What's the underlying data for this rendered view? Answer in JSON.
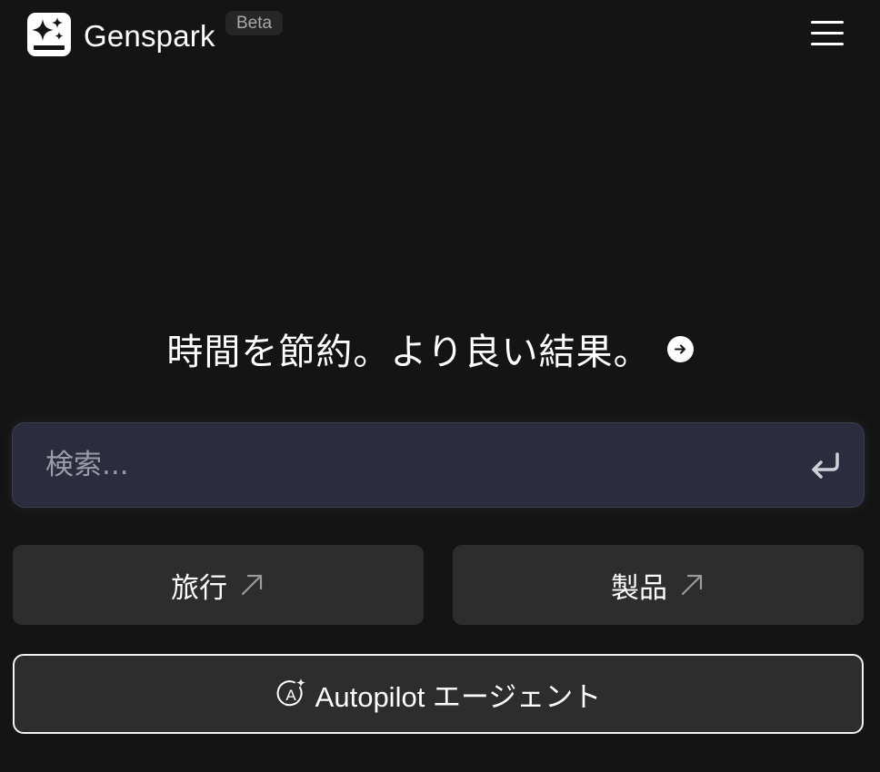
{
  "header": {
    "brand": "Genspark",
    "badge": "Beta",
    "logo_icon": "sparkle-logo-icon",
    "menu_icon": "hamburger-menu-icon"
  },
  "hero": {
    "headline": "時間を節約。より良い結果。",
    "arrow_icon": "arrow-right-circle-icon"
  },
  "search": {
    "placeholder": "検索...",
    "value": "",
    "submit_icon": "enter-return-icon"
  },
  "suggestions": [
    {
      "label": "旅行",
      "icon": "arrow-up-right-icon"
    },
    {
      "label": "製品",
      "icon": "arrow-up-right-icon"
    }
  ],
  "autopilot": {
    "label": "Autopilot エージェント",
    "icon": "autopilot-sparkle-icon"
  },
  "colors": {
    "background": "#141414",
    "search_background": "#2b2d3e",
    "card_background": "#2d2d2d",
    "text": "#ffffff"
  }
}
